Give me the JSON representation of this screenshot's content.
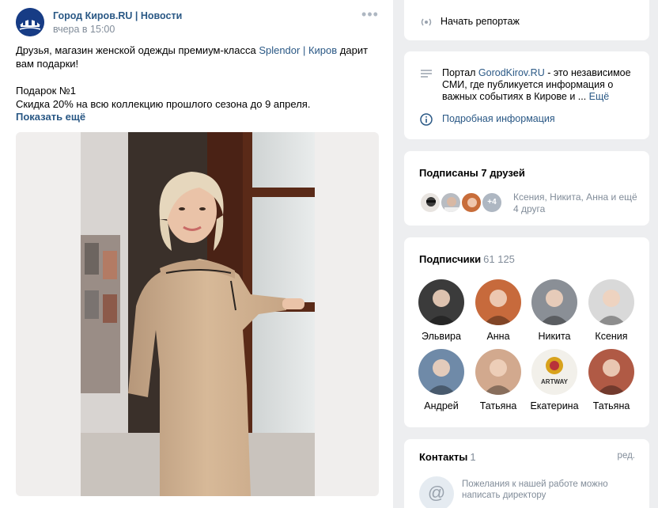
{
  "post": {
    "author": "Город Киров.RU | Новости",
    "time": "вчера в 15:00",
    "text_line1_before": "Друзья, магазин женской одежды премиум-класса ",
    "text_link1": "Splendor | Киров",
    "text_line1_after": " дарит вам подарки!",
    "gift_title": "Подарок №1",
    "gift_text": "Скидка 20% на всю коллекцию прошлого сезона до 9 апреля.",
    "show_more": "Показать ещё"
  },
  "reportage": {
    "label": "Начать репортаж"
  },
  "about": {
    "prefix": "Портал ",
    "link": "GorodKirov.RU",
    "text": " - это независимое СМИ, где публикуется информация о важных событиях в Кирове и ... ",
    "more": "Ещё",
    "details": "Подробная информация"
  },
  "friends": {
    "title": "Подписаны 7 друзей",
    "extra_badge": "+4",
    "names_line1": "Ксения, Никита, Анна и ещё",
    "names_line2": "4 друга"
  },
  "subscribers": {
    "title": "Подписчики",
    "count": "61 125",
    "items": [
      {
        "name": "Эльвира",
        "color": "#3b3b3b"
      },
      {
        "name": "Анна",
        "color": "#c76a3c"
      },
      {
        "name": "Никита",
        "color": "#8a8f96"
      },
      {
        "name": "Ксения",
        "color": "#d9d9d9"
      },
      {
        "name": "Андрей",
        "color": "#6f8aa8"
      },
      {
        "name": "Татьяна",
        "color": "#d2a98e"
      },
      {
        "name": "Екатерина",
        "color": "#f2f0ea"
      },
      {
        "name": "Татьяна",
        "color": "#b05a45"
      }
    ]
  },
  "artway_logo": "ARTWAY",
  "contacts": {
    "title": "Контакты",
    "count": "1",
    "edit": "ред.",
    "contact_text1": "Пожелания к нашей работе можно",
    "contact_text2": "написать директору"
  },
  "colors": {
    "link": "#2a5885",
    "muted": "#818c99",
    "bg": "#edeef0"
  }
}
